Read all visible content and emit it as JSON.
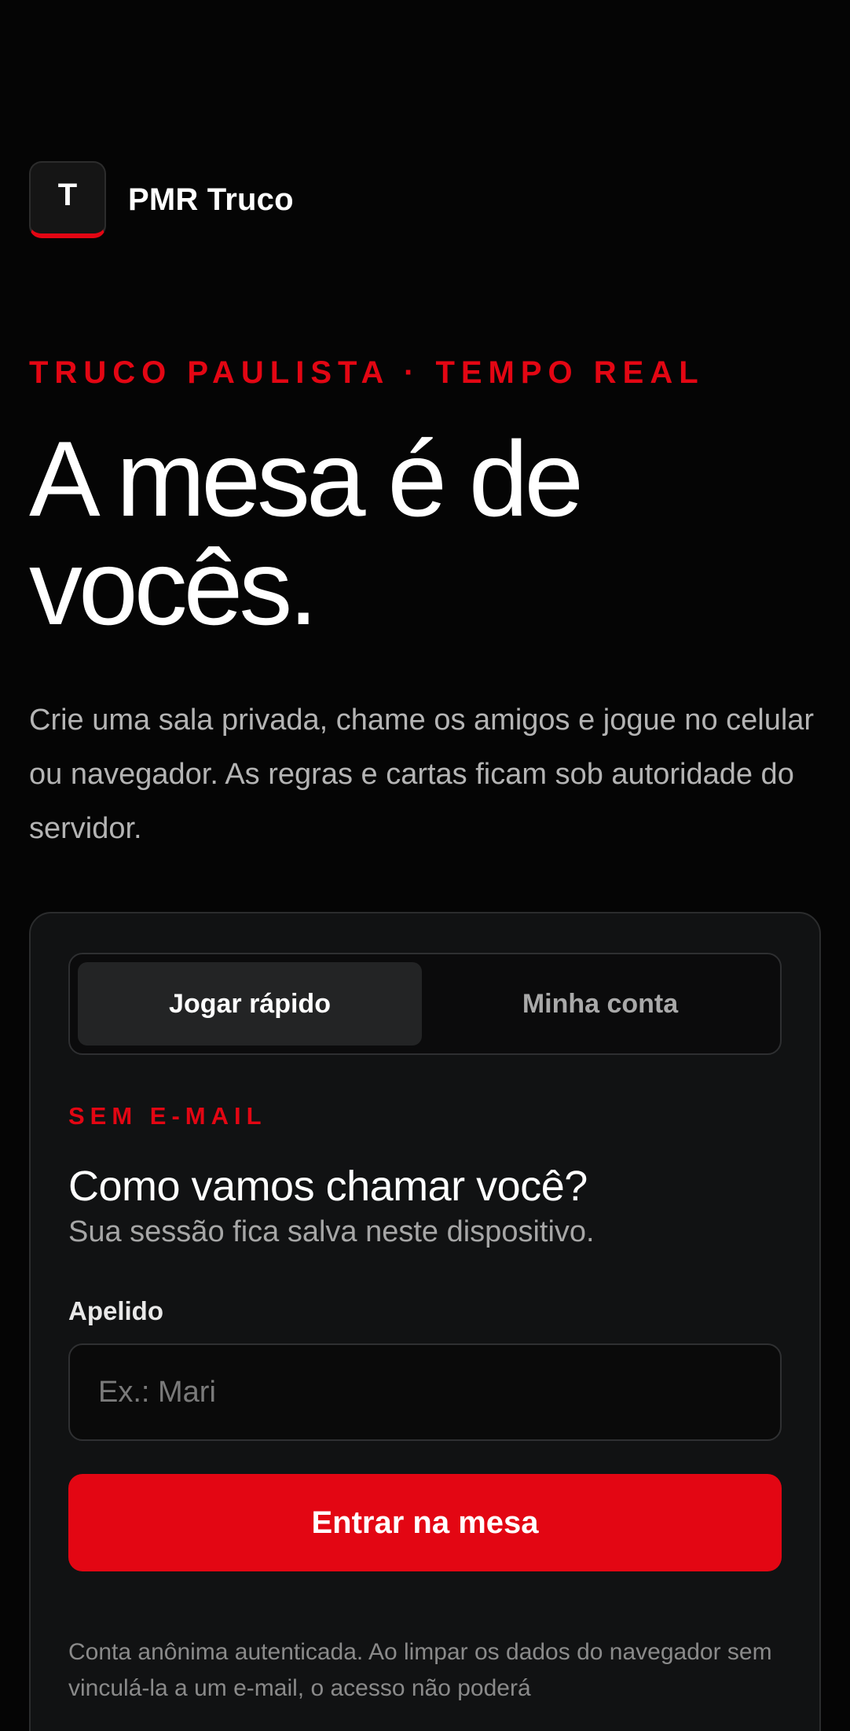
{
  "brand": {
    "logo_letter": "T",
    "name": "PMR Truco"
  },
  "hero": {
    "eyebrow": "TRUCO PAULISTA · TEMPO REAL",
    "title": "A mesa é de vocês.",
    "description": "Crie uma sala privada, chame os amigos e jogue no celular ou navegador. As regras e cartas ficam sob autoridade do servidor."
  },
  "card": {
    "tabs": [
      {
        "label": "Jogar rápido",
        "active": true
      },
      {
        "label": "Minha conta",
        "active": false
      }
    ],
    "eyebrow": "SEM E-MAIL",
    "title": "Como vamos chamar você?",
    "subtitle": "Sua sessão fica salva neste dispositivo.",
    "field_label": "Apelido",
    "input_placeholder": "Ex.: Mari",
    "input_value": "",
    "submit_label": "Entrar na mesa",
    "note": "Conta anônima autenticada. Ao limpar os dados do navegador sem vinculá-la a um e-mail, o acesso não poderá"
  },
  "colors": {
    "background": "#050505",
    "accent": "#e30613",
    "card": "#111213"
  }
}
